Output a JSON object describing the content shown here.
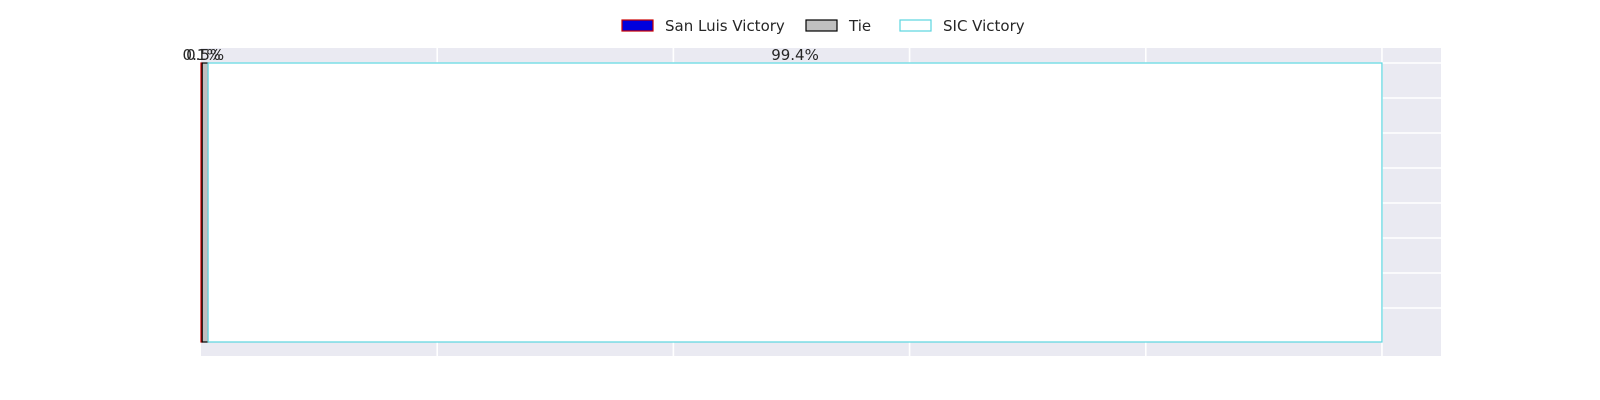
{
  "chart_data": {
    "type": "bar",
    "orientation": "horizontal",
    "stacked": true,
    "categories": [
      ""
    ],
    "series": [
      {
        "name": "San Luis Victory",
        "values": [
          0.1
        ],
        "label": "0.1%",
        "fill": "#0000dd",
        "edge": "#cc0000"
      },
      {
        "name": "Tie",
        "values": [
          0.5
        ],
        "label": "0.5%",
        "fill": "#c0c0c0",
        "edge": "#000000"
      },
      {
        "name": "SIC Victory",
        "values": [
          99.4
        ],
        "label": "99.4%",
        "fill": "#ffffff",
        "edge": "#5bd5e0"
      }
    ],
    "xlim": [
      0,
      105
    ],
    "grid": true,
    "legend": "top-center",
    "title": "",
    "xlabel": "",
    "ylabel": ""
  }
}
